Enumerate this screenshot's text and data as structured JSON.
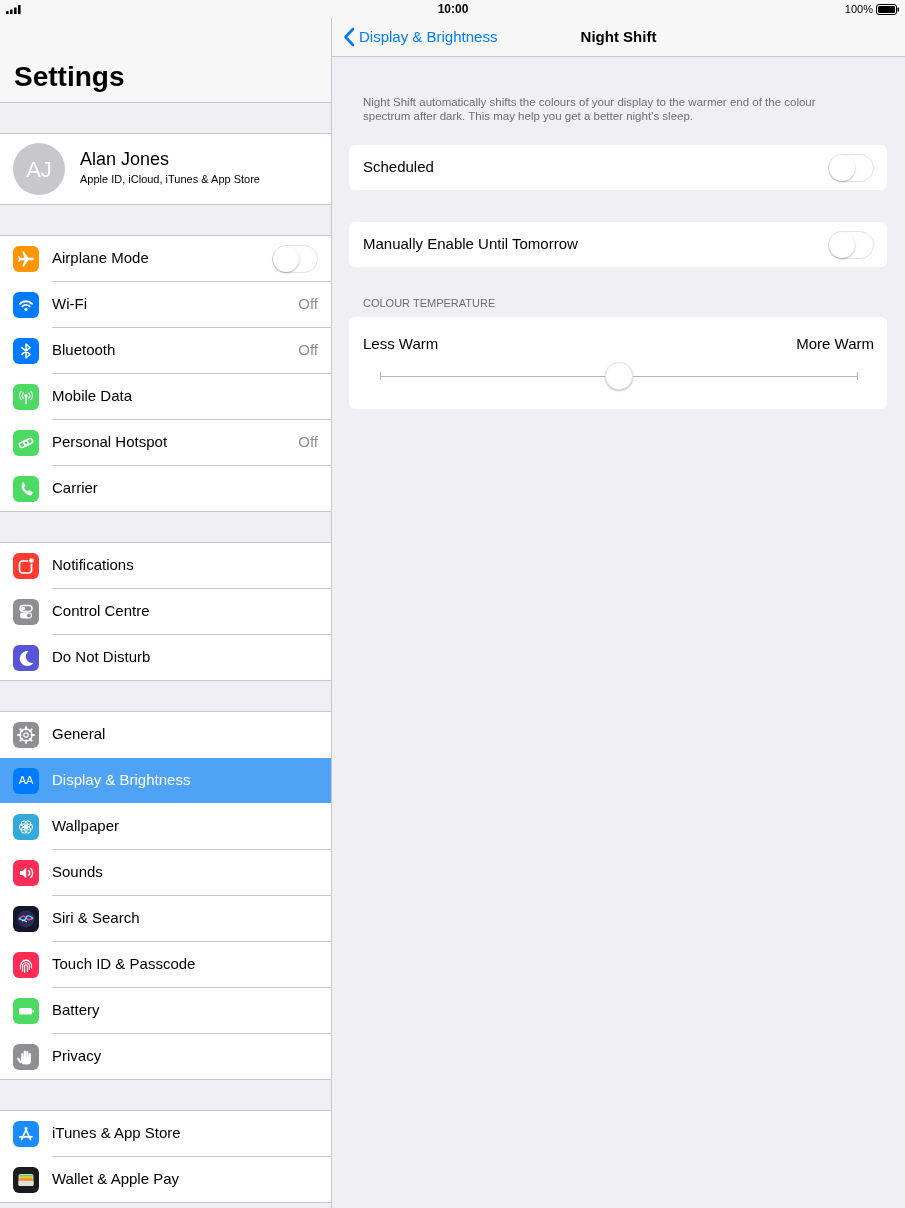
{
  "status_bar": {
    "time": "10:00",
    "battery": "100%"
  },
  "sidebar": {
    "title": "Settings",
    "profile": {
      "initials": "AJ",
      "name": "Alan Jones",
      "subtitle": "Apple ID, iCloud, iTunes & App Store"
    },
    "groups": [
      {
        "items": [
          {
            "kind": "toggle",
            "label": "Airplane Mode",
            "on": false,
            "selected": false
          },
          {
            "kind": "link",
            "label": "Wi-Fi",
            "value": "Off",
            "selected": false
          },
          {
            "kind": "link",
            "label": "Bluetooth",
            "value": "Off",
            "selected": false
          },
          {
            "kind": "link",
            "label": "Mobile Data",
            "selected": false
          },
          {
            "kind": "link",
            "label": "Personal Hotspot",
            "value": "Off",
            "selected": false
          },
          {
            "kind": "link",
            "label": "Carrier",
            "selected": false
          }
        ]
      },
      {
        "items": [
          {
            "kind": "link",
            "label": "Notifications",
            "selected": false
          },
          {
            "kind": "link",
            "label": "Control Centre",
            "selected": false
          },
          {
            "kind": "link",
            "label": "Do Not Disturb",
            "selected": false
          }
        ]
      },
      {
        "items": [
          {
            "kind": "link",
            "label": "General",
            "selected": false
          },
          {
            "kind": "link",
            "label": "Display & Brightness",
            "icon_text": "AA",
            "selected": true
          },
          {
            "kind": "link",
            "label": "Wallpaper",
            "selected": false
          },
          {
            "kind": "link",
            "label": "Sounds",
            "selected": false
          },
          {
            "kind": "link",
            "label": "Siri & Search",
            "selected": false
          },
          {
            "kind": "link",
            "label": "Touch ID & Passcode",
            "selected": false
          },
          {
            "kind": "link",
            "label": "Battery",
            "selected": false
          },
          {
            "kind": "link",
            "label": "Privacy",
            "selected": false
          }
        ]
      },
      {
        "items": [
          {
            "kind": "link",
            "label": "iTunes & App Store",
            "selected": false
          },
          {
            "kind": "link",
            "label": "Wallet & Apple Pay",
            "selected": false
          }
        ]
      }
    ]
  },
  "detail": {
    "nav_bar": {
      "back": "Display & Brightness",
      "title": "Night Shift"
    },
    "description": "Night Shift automatically shifts the colours of your display to the warmer end of the colour spectrum after dark. This may help you get a better night’s sleep.",
    "toggles": [
      {
        "label": "Scheduled",
        "on": false
      },
      {
        "label": "Manually Enable Until Tomorrow",
        "on": false
      }
    ],
    "colour_temperature": {
      "header": "COLOUR TEMPERATURE",
      "min_label": "Less Warm",
      "max_label": "More Warm",
      "level": 0.5
    }
  }
}
